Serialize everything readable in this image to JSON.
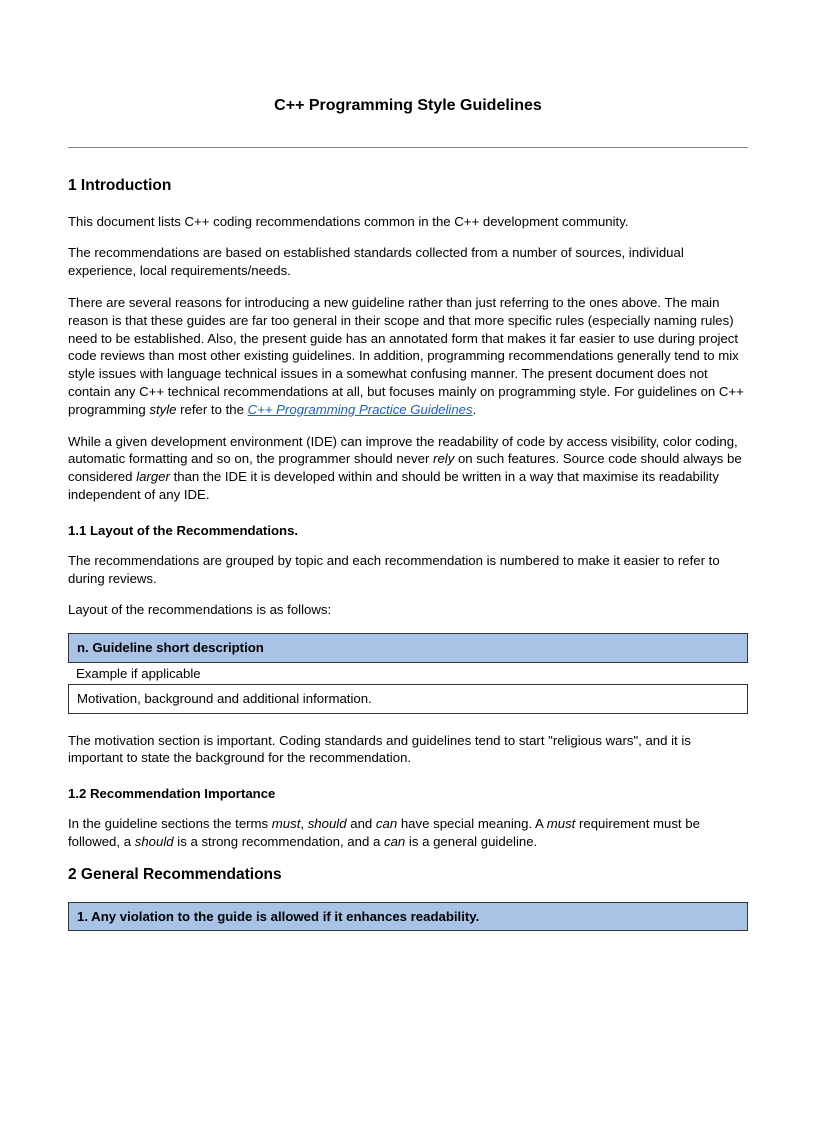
{
  "title": "C++ Programming Style Guidelines",
  "section1": {
    "heading": "1 Introduction",
    "p1": "This document lists C++ coding recommendations common in the C++ development community.",
    "p2": "The recommendations are based on established standards collected from a number of sources, individual experience, local requirements/needs.",
    "p3a": "There are several reasons for introducing a new guideline rather than just referring to the ones above. The main reason is that these guides are far too general in their scope and that more specific rules (especially naming rules) need to be established. Also, the present guide has an annotated form that makes it far easier to use during project code reviews than most other existing guidelines. In addition, programming recommendations generally tend to mix style issues with language technical issues in a somewhat confusing manner. The present document does not contain any C++ technical recommendations at all, but focuses mainly on programming style. For guidelines on C++ programming ",
    "p3_style": "style",
    "p3b": " refer to the ",
    "p3_link": "C++ Programming Practice Guidelines",
    "p3c": ".",
    "p4a": "While a given development environment (IDE) can improve the readability of code by access visibility, color coding, automatic formatting and so on, the programmer should never ",
    "p4_rely": "rely",
    "p4b": " on such features. Source code should always be considered ",
    "p4_larger": "larger",
    "p4c": " than the IDE it is developed within and should be written in a way that maximise its readability independent of any IDE."
  },
  "section1_1": {
    "heading": "1.1 Layout of the Recommendations.",
    "p1": "The recommendations are grouped by topic and each recommendation is numbered to make it easier to refer to during reviews.",
    "p2": "Layout of the recommendations is as follows:",
    "box_header": "n. Guideline short description",
    "box_example": "Example if applicable",
    "box_motivation": "Motivation, background and additional information.",
    "p3": "The motivation section is important. Coding standards and guidelines tend to start \"religious wars\", and it is important to state the background for the recommendation."
  },
  "section1_2": {
    "heading": "1.2 Recommendation Importance",
    "p1a": "In the guideline sections the terms ",
    "must": "must",
    "p1b": ", ",
    "should": "should",
    "p1c": " and ",
    "can": "can",
    "p1d": " have special meaning. A ",
    "must2": "must",
    "p1e": " requirement must be followed, a ",
    "should2": "should",
    "p1f": " is a strong recommendation, and a ",
    "can2": "can",
    "p1g": " is a general guideline."
  },
  "section2": {
    "heading": "2 General Recommendations",
    "box1": "1. Any violation to the guide is allowed if it enhances readability."
  }
}
